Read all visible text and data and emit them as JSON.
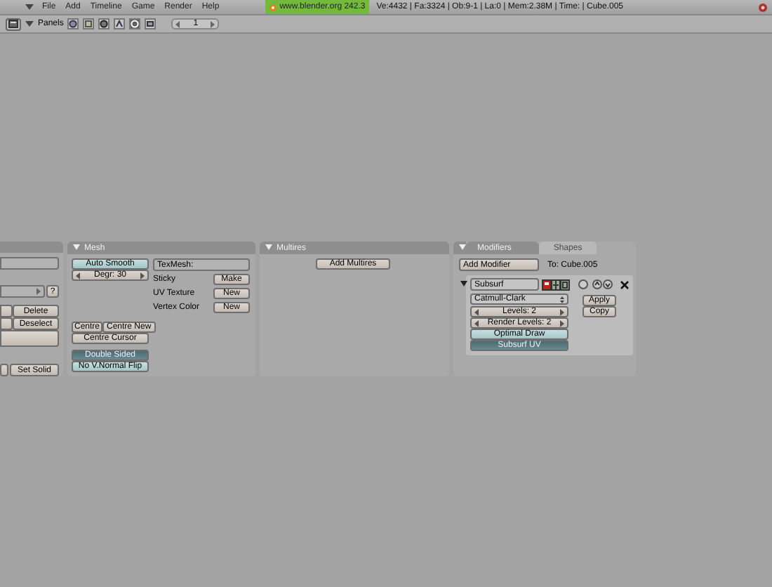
{
  "menu": [
    "File",
    "Add",
    "Timeline",
    "Game",
    "Render",
    "Help"
  ],
  "site_badge": "www.blender.org 242.3",
  "stats": "Ve:4432 | Fa:3324 | Ob:9-1 | La:0 | Mem:2.38M | Time: | Cube.005",
  "toolbar": {
    "panels_label": "Panels",
    "frame": "1",
    "context_buttons": [
      {
        "selected": false
      },
      {
        "selected": false
      },
      {
        "selected": false
      },
      {
        "selected": false
      },
      {
        "selected": true
      },
      {
        "selected": false
      }
    ]
  },
  "left_panel": {
    "help": "?",
    "buttons": [
      "Delete",
      "Deselect"
    ],
    "bottom_button": "Set Solid"
  },
  "mesh_panel": {
    "title": "Mesh",
    "auto_smooth": {
      "label": "Auto Smooth",
      "on": false
    },
    "degr": "Degr: 30",
    "texmesh": "TexMesh:",
    "rows": [
      {
        "label": "Sticky",
        "button": "Make"
      },
      {
        "label": "UV Texture",
        "button": "New"
      },
      {
        "label": "Vertex Color",
        "button": "New"
      }
    ],
    "centre_buttons": [
      "Centre",
      "Centre New",
      "Centre Cursor"
    ],
    "toggles": [
      {
        "label": "Double Sided",
        "on": true
      },
      {
        "label": "No V.Normal Flip",
        "on": false
      }
    ]
  },
  "multires_panel": {
    "title": "Multires",
    "button": "Add Multires"
  },
  "modifiers_panel": {
    "tabs": [
      {
        "label": "Modifiers",
        "selected": true
      },
      {
        "label": "Shapes",
        "selected": false
      }
    ],
    "add_button": "Add Modifier",
    "target": "To: Cube.005",
    "modifier": {
      "name": "Subsurf",
      "expanded": true,
      "type": "Catmull-Clark",
      "levels": "Levels: 2",
      "render_levels": "Render Levels: 2",
      "toggles": [
        {
          "label": "Optimal Draw",
          "on": false
        },
        {
          "label": "Subsurf UV",
          "on": true
        }
      ],
      "actions": [
        "Apply",
        "Copy"
      ]
    }
  }
}
